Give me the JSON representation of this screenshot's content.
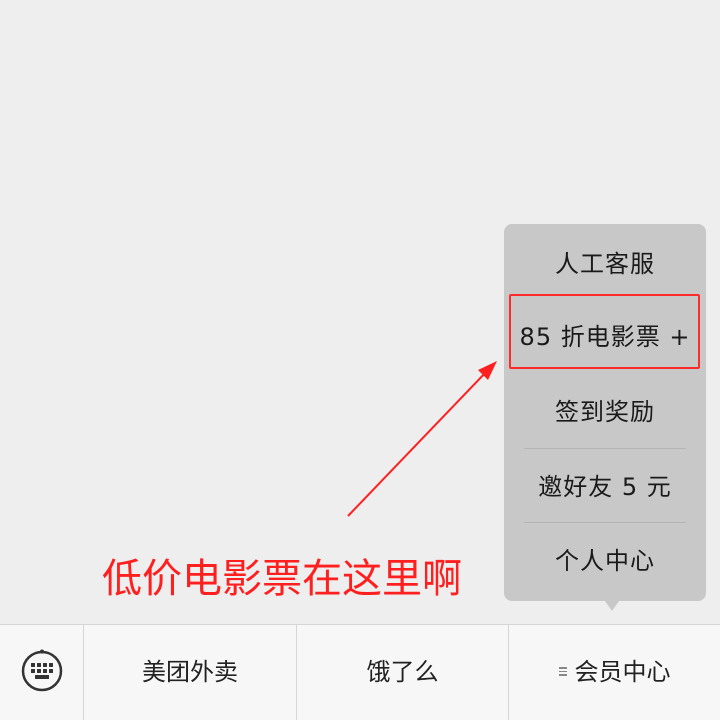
{
  "popup_menu": {
    "items": [
      {
        "label": "人工客服"
      },
      {
        "label": "85 折电影票 +"
      },
      {
        "label": "签到奖励"
      },
      {
        "label": "邀好友 5 元"
      },
      {
        "label": "个人中心"
      }
    ],
    "highlighted_index": 1
  },
  "annotation": {
    "text": "低价电影票在这里啊",
    "color": "#ff1f1f"
  },
  "bottom_bar": {
    "tabs": [
      {
        "label": "美团外卖"
      },
      {
        "label": "饿了么"
      },
      {
        "label": "会员中心",
        "icon": "menu-lines-icon"
      }
    ],
    "keyboard_icon": "keyboard-icon"
  },
  "colors": {
    "menu_background": "#c8c8c8",
    "highlight_border": "#ff2a2a",
    "chat_background": "#eeeeee",
    "bar_background": "#f7f7f7"
  }
}
